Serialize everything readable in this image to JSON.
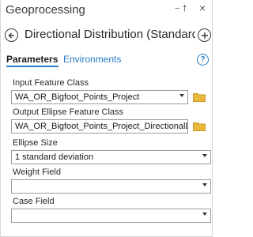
{
  "pane": {
    "title": "Geoprocessing",
    "pin_glyph": "− †",
    "close_glyph": "×"
  },
  "header": {
    "tool_title": "Directional Distribution (Standard…"
  },
  "tabs": {
    "parameters": "Parameters",
    "environments": "Environments",
    "help_glyph": "?"
  },
  "form": {
    "input_feature_class": {
      "label": "Input Feature Class",
      "value": "WA_OR_Bigfoot_Points_Project"
    },
    "output_ellipse": {
      "label": "Output Ellipse Feature Class",
      "value": "WA_OR_Bigfoot_Points_Project_DirectionalDi"
    },
    "ellipse_size": {
      "label": "Ellipse Size",
      "value": "1 standard deviation"
    },
    "weight_field": {
      "label": "Weight Field",
      "value": ""
    },
    "case_field": {
      "label": "Case Field",
      "value": ""
    }
  },
  "colors": {
    "accent": "#2a7cc7",
    "folder": "#e8b93a"
  }
}
